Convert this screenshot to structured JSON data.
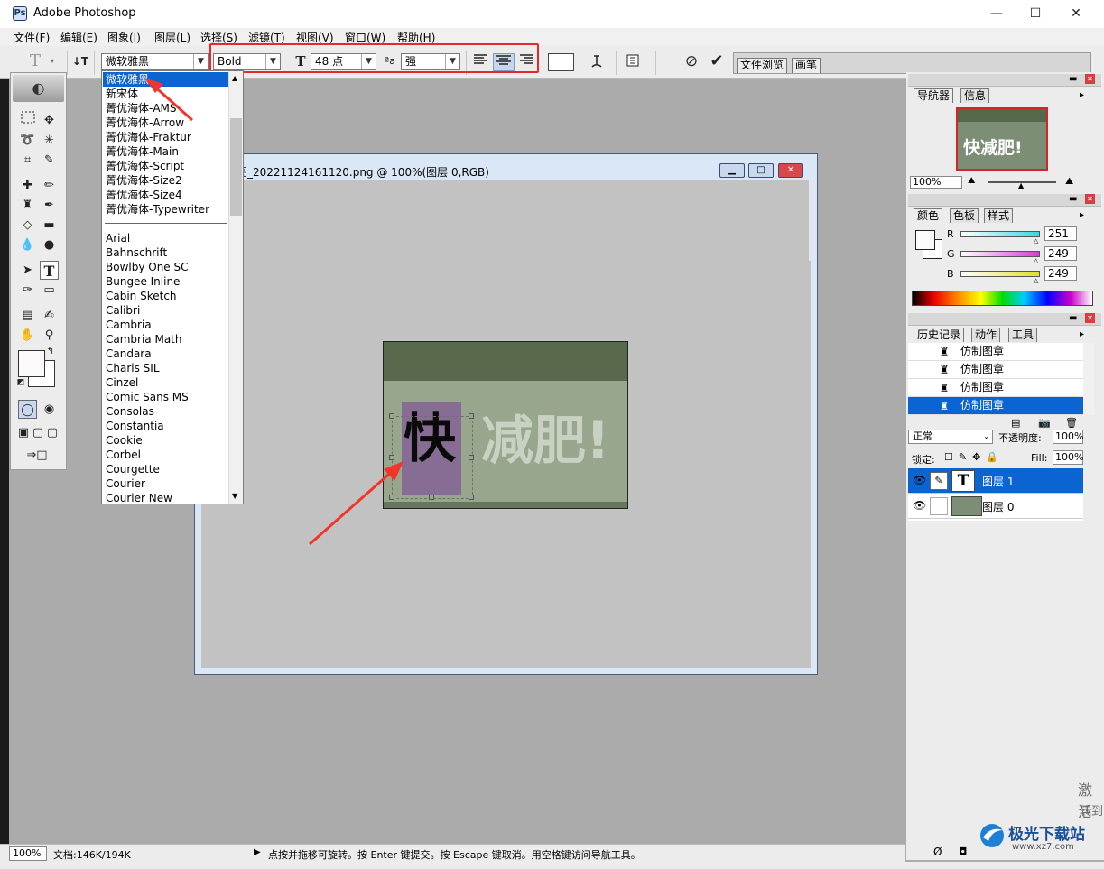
{
  "app": {
    "title": "Adobe Photoshop"
  },
  "window_controls": [
    "—",
    "☐",
    "✕"
  ],
  "menu": [
    "文件(F)",
    "编辑(E)",
    "图象(I)",
    "图层(L)",
    "选择(S)",
    "滤镜(T)",
    "视图(V)",
    "窗口(W)",
    "帮助(H)"
  ],
  "options": {
    "tool_glyph": "T",
    "font_family": "微软雅黑",
    "font_style": "Bold",
    "font_size": "48 点",
    "antialias_icon_label": "ªa",
    "antialias": "强",
    "palette_tabs": [
      "文件浏览",
      "画笔"
    ]
  },
  "font_list": {
    "selected": "微软雅黑",
    "cjk": [
      "新宋体",
      "菁优海体-AMS",
      "菁优海体-Arrow",
      "菁优海体-Fraktur",
      "菁优海体-Main",
      "菁优海体-Script",
      "菁优海体-Size2",
      "菁优海体-Size4",
      "菁优海体-Typewriter"
    ],
    "latin": [
      "Arial",
      "Bahnschrift",
      "Bowlby One SC",
      "Bungee Inline",
      "Cabin Sketch",
      "Calibri",
      "Cambria",
      "Cambria Math",
      "Candara",
      "Charis SIL",
      "Cinzel",
      "Comic Sans MS",
      "Consolas",
      "Constantia",
      "Cookie",
      "Corbel",
      "Courgette",
      "Courier",
      "Courier New"
    ]
  },
  "document": {
    "title": "截图_20221124161120.png @ 100%(图层 0,RGB)",
    "canvas_text_first": "快",
    "canvas_text_rest": "减肥!"
  },
  "navigator": {
    "tabs": [
      "导航器",
      "信息"
    ],
    "zoom": "100%",
    "thumb_text": "快减肥!"
  },
  "color": {
    "tabs": [
      "颜色",
      "色板",
      "样式"
    ],
    "channels": [
      {
        "label": "R",
        "value": "251",
        "color": "#35d8e0"
      },
      {
        "label": "G",
        "value": "249",
        "color": "#d63bd6"
      },
      {
        "label": "B",
        "value": "249",
        "color": "#e0e02a"
      }
    ]
  },
  "history": {
    "tabs": [
      "历史记录",
      "动作",
      "工具"
    ],
    "items": [
      "仿制图章",
      "仿制图章",
      "仿制图章",
      "仿制图章"
    ]
  },
  "layers": {
    "blend_mode": "正常",
    "opacity_label": "不透明度:",
    "opacity": "100%",
    "lock_label": "锁定:",
    "fill_label": "Fill:",
    "fill": "100%",
    "rows": [
      {
        "name": "图层 1",
        "thumb": "T"
      },
      {
        "name": "图层 0",
        "thumb": ""
      }
    ]
  },
  "status": {
    "zoom": "100%",
    "doc_size": "文档:146K/194K",
    "hint": "点按并拖移可旋转。按 Enter 键提交。按 Escape 键取消。用空格键访问导航工具。"
  },
  "side_fragments": [
    "激活",
    "转到"
  ],
  "watermark": {
    "title": "极光下载站",
    "url": "www.xz7.com"
  },
  "accent": {
    "selection": "#0a64d2",
    "highlight": "#e8282f",
    "arrow": "#f2352b"
  }
}
